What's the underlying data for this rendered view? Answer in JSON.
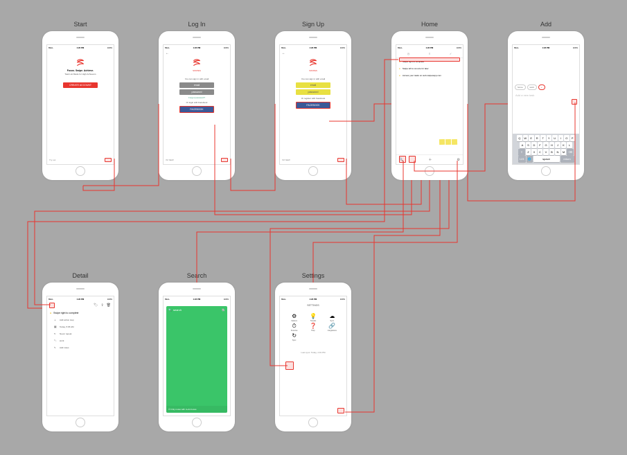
{
  "screens": {
    "start": {
      "label": "Start",
      "time": "1:23 PM",
      "carrier": "BELL",
      "battery": "100%",
      "brand": "SWIPES",
      "tagline1": "Focus. Swipe. Achieve.",
      "tagline2": "Task List Made for High Achievers",
      "btn_create": "CREATE ACCOUNT",
      "footer": "Try out"
    },
    "login": {
      "label": "Log In",
      "time": "1:23 PM",
      "brand": "SWIPES",
      "lead": "You can sign in with email",
      "input_email": "email",
      "input_password": "password",
      "forgot": "Forgot password?",
      "or": "Or login with Facebook",
      "btn_fb": "FACEBOOK",
      "footer": "I'M NEW"
    },
    "signup": {
      "label": "Sign Up",
      "time": "1:23 PM",
      "brand": "SWIPES",
      "lead": "You can sign in with email",
      "input_email": "email",
      "input_password": "password",
      "or": "Or register with Facebook",
      "btn_fb": "FACEBOOK",
      "footer": "I'M NEW"
    },
    "home": {
      "label": "Home",
      "time": "1:23 PM",
      "task1": "Swipe right to complete",
      "task2": "Swipe left to snooze for later",
      "task3": "Access your tasks on web.swipesapp.com"
    },
    "add": {
      "label": "Add",
      "time": "1:23 PM",
      "tag1": "home",
      "tag2": "work",
      "placeholder": "Add a new task",
      "keys_r1": [
        "Q",
        "W",
        "E",
        "R",
        "T",
        "Y",
        "U",
        "I",
        "O",
        "P"
      ],
      "keys_r2": [
        "A",
        "S",
        "D",
        "F",
        "G",
        "H",
        "J",
        "K",
        "L"
      ],
      "keys_r3": [
        "Z",
        "X",
        "C",
        "V",
        "B",
        "N",
        "M"
      ],
      "key_shift": "⇧",
      "key_del": "⌫",
      "key_123": "123",
      "key_globe": "🌐",
      "key_space": "space",
      "key_return": "return"
    },
    "detail": {
      "label": "Detail",
      "time": "1:23 PM",
      "title": "Swipe right to complete",
      "row1": "Add action step",
      "row2": "Today, 5:05 AM",
      "row3": "Never repeat",
      "row4": "work",
      "row5": "Add notes"
    },
    "search": {
      "label": "Search",
      "time": "1:23 PM",
      "placeholder": "search",
      "footer": "Only notes with to-do boxes"
    },
    "settings": {
      "label": "Settings",
      "time": "1:23 PM",
      "title": "SETTINGS",
      "items": [
        {
          "icon": "⚙",
          "label": "Options"
        },
        {
          "icon": "💡",
          "label": "Tweaks"
        },
        {
          "icon": "☁",
          "label": "Sync"
        },
        {
          "icon": "⏱",
          "label": "Snoozes"
        },
        {
          "icon": "❓",
          "label": "Help"
        },
        {
          "icon": "🔗",
          "label": "Integrations"
        },
        {
          "icon": "↻",
          "label": "Sync"
        }
      ],
      "lastsync": "Last sync: Today, 4:19 PM"
    }
  }
}
